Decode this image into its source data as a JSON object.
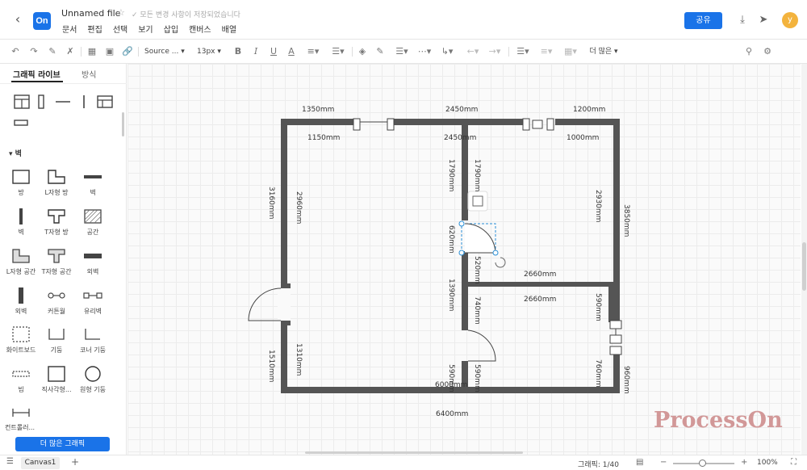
{
  "header": {
    "logo_text": "On",
    "file_name": "Unnamed file",
    "save_status": "모든 변경 사항이 저장되었습니다",
    "menus": [
      "문서",
      "편집",
      "선택",
      "보기",
      "삽입",
      "캔버스",
      "배열"
    ],
    "share_label": "공유",
    "avatar_letter": "y"
  },
  "toolbar": {
    "font_name": "Source ...",
    "font_size": "13px",
    "bold": "B",
    "italic": "I",
    "underline": "U",
    "text_color": "A",
    "more_label": "더 많은"
  },
  "left_panel": {
    "tab_shapes": "그래픽 라이브",
    "tab_style": "방식",
    "section_title": "벽",
    "shape_labels": [
      "방",
      "L자형 방",
      "벽",
      "벽",
      "T자형 방",
      "공간",
      "L자형 공간",
      "T자형 공간",
      "외벽",
      "외벽",
      "커튼월",
      "유리벽",
      "화이트보드",
      "기둥",
      "코너 기둥",
      "빔",
      "직사각형...",
      "원형 기둥",
      "컨트롤러..."
    ],
    "more_shapes_label": "더 많은 그래픽"
  },
  "canvas": {
    "dimensions": [
      "1350mm",
      "2450mm",
      "1200mm",
      "1150mm",
      "2450mm",
      "1000mm",
      "1790mm",
      "1790mm",
      "3160mm",
      "2960mm",
      "2930mm",
      "3850mm",
      "620mm",
      "520mm",
      "2660mm",
      "2660mm",
      "1390mm",
      "740mm",
      "590mm",
      "1510mm",
      "1310mm",
      "590mm",
      "590mm",
      "6000mm",
      "760mm",
      "960mm",
      "6400mm"
    ],
    "watermark": "ProcessOn"
  },
  "bottom_bar": {
    "canvas_tab": "Canvas1",
    "shape_count": "그래픽: 1/40",
    "zoom": "100%"
  },
  "colors": {
    "accent": "#1a73e8",
    "wall": "#555555",
    "avatar": "#f3b33d"
  }
}
